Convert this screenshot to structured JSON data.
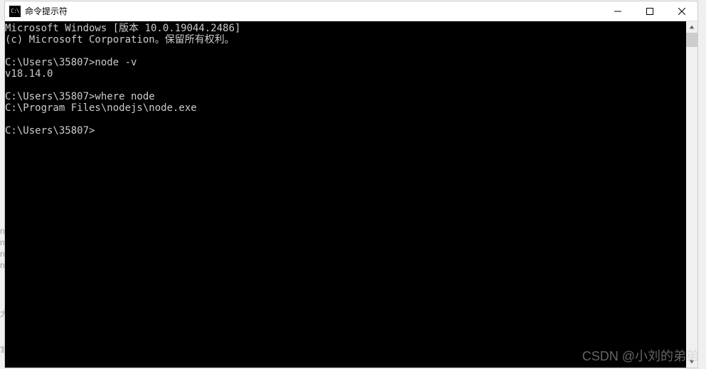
{
  "titlebar": {
    "icon_label": "C:\\",
    "title": "命令提示符"
  },
  "terminal": {
    "lines": [
      "Microsoft Windows [版本 10.0.19044.2486]",
      "(c) Microsoft Corporation。保留所有权利。",
      "",
      "C:\\Users\\35807>node -v",
      "v18.14.0",
      "",
      "C:\\Users\\35807>where node",
      "C:\\Program Files\\nodejs\\node.exe",
      "",
      "C:\\Users\\35807>"
    ]
  },
  "watermark": "CSDN @小刘的弟弟",
  "background_hints": {
    "left_chars": [
      "n",
      "n",
      "n",
      "n"
    ],
    "da": "大",
    "xie": "写"
  }
}
